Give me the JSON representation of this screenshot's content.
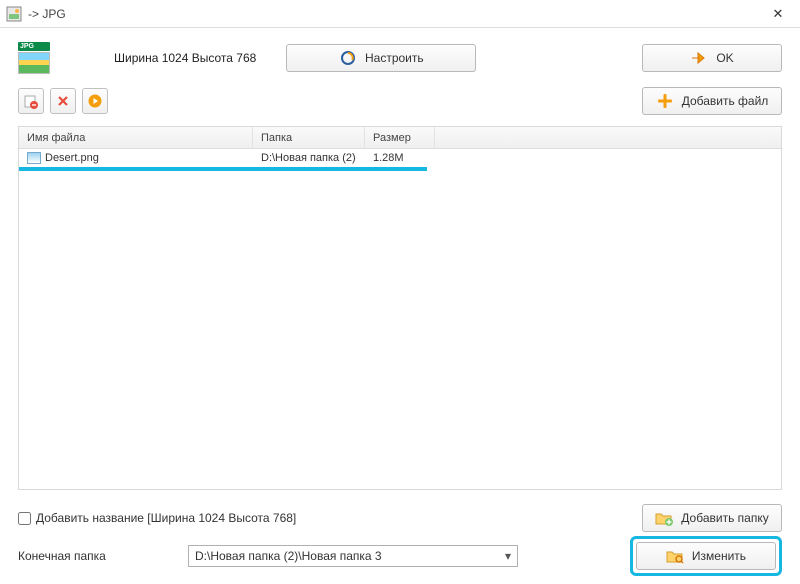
{
  "title": "-> JPG",
  "dimensions": "Ширина 1024 Высота 768",
  "buttons": {
    "configure": "Настроить",
    "ok": "OK",
    "add_file": "Добавить файл",
    "add_folder": "Добавить папку",
    "change": "Изменить"
  },
  "table": {
    "headers": {
      "name": "Имя файла",
      "folder": "Папка",
      "size": "Размер"
    },
    "rows": [
      {
        "name": "Desert.png",
        "folder": "D:\\Новая папка (2)",
        "size": "1.28M"
      }
    ]
  },
  "checkbox": {
    "label": "Добавить название [Ширина 1024 Высота 768]"
  },
  "dest": {
    "label": "Конечная папка",
    "value": "D:\\Новая папка (2)\\Новая папка 3"
  }
}
